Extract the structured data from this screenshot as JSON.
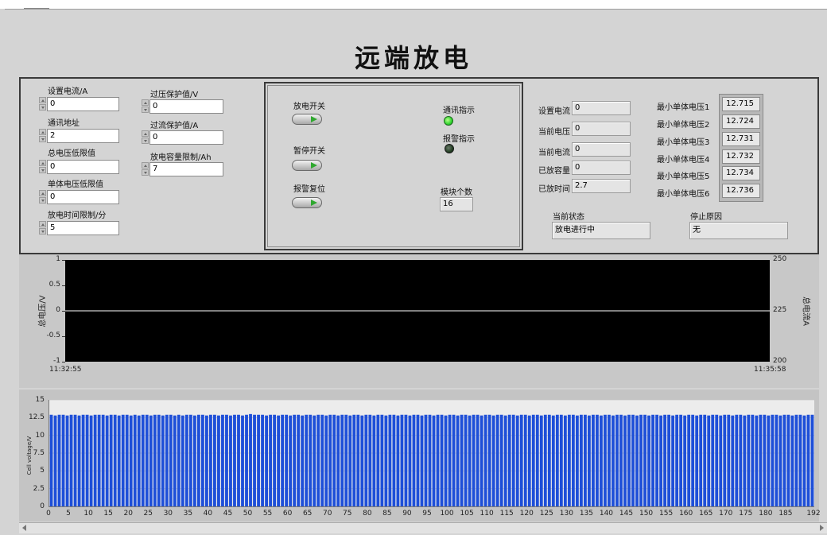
{
  "title": "远端放电",
  "settings_left": [
    {
      "label": "设置电流/A",
      "value": "0"
    },
    {
      "label": "通讯地址",
      "value": "2"
    },
    {
      "label": "总电压低限值",
      "value": "0"
    },
    {
      "label": "单体电压低限值",
      "value": "0"
    },
    {
      "label": "放电时间限制/分",
      "value": "5"
    }
  ],
  "settings_right": [
    {
      "label": "过压保护值/V",
      "value": "0"
    },
    {
      "label": "过流保护值/A",
      "value": "0"
    },
    {
      "label": "放电容量限制/Ah",
      "value": "7"
    }
  ],
  "controls": {
    "discharge_switch": "放电开关",
    "pause_switch": "暂停开关",
    "alarm_reset": "报警复位",
    "comm_indicator": "通讯指示",
    "alarm_indicator": "报警指示",
    "module_count_label": "模块个数",
    "module_count": "16",
    "comm_on": true,
    "alarm_on": false
  },
  "readouts": [
    {
      "label": "设置电流",
      "value": "0"
    },
    {
      "label": "当前电压",
      "value": "0"
    },
    {
      "label": "当前电流",
      "value": "0"
    },
    {
      "label": "已放容量",
      "value": "0"
    },
    {
      "label": "已放时间",
      "value": "2.7"
    }
  ],
  "min_cells": [
    {
      "label": "最小单体电压1",
      "value": "12.715"
    },
    {
      "label": "最小单体电压2",
      "value": "12.724"
    },
    {
      "label": "最小单体电压3",
      "value": "12.731"
    },
    {
      "label": "最小单体电压4",
      "value": "12.732"
    },
    {
      "label": "最小单体电压5",
      "value": "12.734"
    },
    {
      "label": "最小单体电压6",
      "value": "12.736"
    }
  ],
  "status": {
    "current_state_label": "当前状态",
    "current_state": "放电进行中",
    "stop_reason_label": "停止原因",
    "stop_reason": "无"
  },
  "chart_data": [
    {
      "type": "line",
      "ylabel": "总电压/V",
      "y2label": "总电流A",
      "ylim": [
        -1,
        1
      ],
      "y2lim": [
        200,
        250
      ],
      "yticks": [
        "1",
        "0.5",
        "0",
        "-0.5",
        "-1"
      ],
      "y2ticks": [
        "250",
        "225",
        "200"
      ],
      "x_start": "11:32:55",
      "x_end": "11:35:58",
      "series": [
        {
          "values": [
            0,
            0
          ]
        }
      ],
      "colors": {
        "background": "#000000",
        "line": "#ffffff"
      }
    },
    {
      "type": "bar",
      "ylabel": "Cell voltage/V",
      "ylim": [
        0,
        15
      ],
      "yticks": [
        "0",
        "2.5",
        "5",
        "7.5",
        "10",
        "12.5",
        "15"
      ],
      "xlim": [
        0,
        192
      ],
      "xticks": [
        "0",
        "5",
        "10",
        "15",
        "20",
        "25",
        "30",
        "35",
        "40",
        "45",
        "50",
        "55",
        "60",
        "65",
        "70",
        "75",
        "80",
        "85",
        "90",
        "95",
        "100",
        "105",
        "110",
        "115",
        "120",
        "125",
        "130",
        "135",
        "140",
        "145",
        "150",
        "155",
        "160",
        "165",
        "170",
        "175",
        "180",
        "185",
        "192"
      ],
      "num_bars": 192,
      "values": [
        12.9,
        12.8,
        12.9,
        12.9,
        12.8,
        12.9,
        12.9,
        12.8,
        12.9,
        12.9,
        12.8,
        12.9,
        12.9,
        12.9,
        12.8,
        12.9,
        12.9,
        12.8,
        12.9,
        12.9,
        12.8,
        12.9,
        12.8,
        12.9,
        12.9,
        12.8,
        12.9,
        12.9,
        12.8,
        12.9,
        12.9,
        12.8,
        12.9,
        12.8,
        12.9,
        12.9,
        12.8,
        12.9,
        12.9,
        12.8,
        12.9,
        12.9,
        12.8,
        12.9,
        12.9,
        12.8,
        12.9,
        12.9,
        12.8,
        12.9,
        13.0,
        12.9,
        12.9,
        12.9,
        12.8,
        12.9,
        12.9,
        12.8,
        12.9,
        12.9,
        12.8,
        12.9,
        12.9,
        12.8,
        12.9,
        12.9,
        12.8,
        12.9,
        12.9,
        12.8,
        12.9,
        12.9,
        12.8,
        12.9,
        12.9,
        12.8,
        12.9,
        12.9,
        12.8,
        12.9,
        12.9,
        12.8,
        12.9,
        12.9,
        12.8,
        12.9,
        12.9,
        12.8,
        12.9,
        12.9,
        12.8,
        12.9,
        12.9,
        12.8,
        12.9,
        12.9,
        12.8,
        12.9,
        12.9,
        12.8,
        12.9,
        12.9,
        12.8,
        12.9,
        12.9,
        12.8,
        12.9,
        12.9,
        12.8,
        12.9,
        12.9,
        12.8,
        12.9,
        12.9,
        12.8,
        12.9,
        12.9,
        12.8,
        12.9,
        12.9,
        12.8,
        12.9,
        12.9,
        12.8,
        12.9,
        12.9,
        12.8,
        12.9,
        12.9,
        12.8,
        12.9,
        12.9,
        12.8,
        12.9,
        12.9,
        12.8,
        12.9,
        12.9,
        12.8,
        12.9,
        12.9,
        12.8,
        12.9,
        12.9,
        12.8,
        12.9,
        12.9,
        12.8,
        12.9,
        12.9,
        12.8,
        12.9,
        12.9,
        12.8,
        12.9,
        12.9,
        12.8,
        12.9,
        12.9,
        12.8,
        12.9,
        12.9,
        12.8,
        12.9,
        12.9,
        12.8,
        12.9,
        12.9,
        12.8,
        12.9,
        12.9,
        12.8,
        12.9,
        12.9,
        12.8,
        12.9,
        12.9,
        12.8,
        12.9,
        12.9,
        12.8,
        12.9,
        12.9,
        12.8,
        12.9,
        12.9,
        12.8,
        12.9,
        12.9,
        12.8,
        12.9,
        12.9,
        12.8,
        12.9
      ],
      "colors": {
        "bar": "#1e4fd8",
        "background": "#ececec"
      }
    }
  ]
}
